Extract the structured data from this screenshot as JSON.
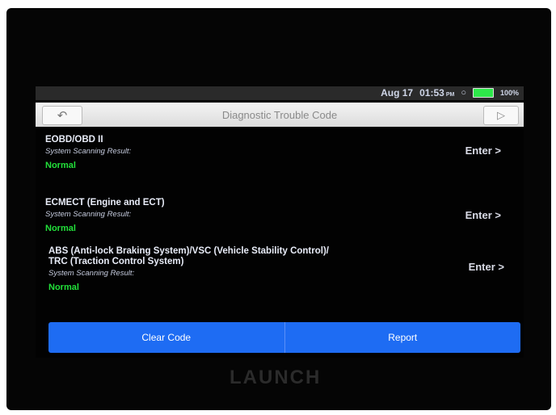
{
  "status": {
    "date": "Aug 17",
    "time": "01:53",
    "ampm": "PM",
    "battery": "100%"
  },
  "header": {
    "title": "Diagnostic Trouble Code"
  },
  "systems": [
    {
      "name": "EOBD/OBD II",
      "sub": "System Scanning Result:",
      "status": "Normal",
      "enter": "Enter >"
    },
    {
      "name": "ECMECT (Engine and ECT)",
      "sub": "System Scanning Result:",
      "status": "Normal",
      "enter": "Enter >"
    },
    {
      "name_line1": "ABS (Anti-lock Braking System)/VSC (Vehicle Stability Control)/",
      "name_line2": "TRC (Traction Control System)",
      "sub": "System Scanning Result:",
      "status": "Normal",
      "enter": "Enter >"
    }
  ],
  "actions": {
    "clear": "Clear Code",
    "report": "Report"
  },
  "brand": "LAUNCH",
  "colors": {
    "accent": "#1e6cf3",
    "ok": "#22e03a"
  }
}
